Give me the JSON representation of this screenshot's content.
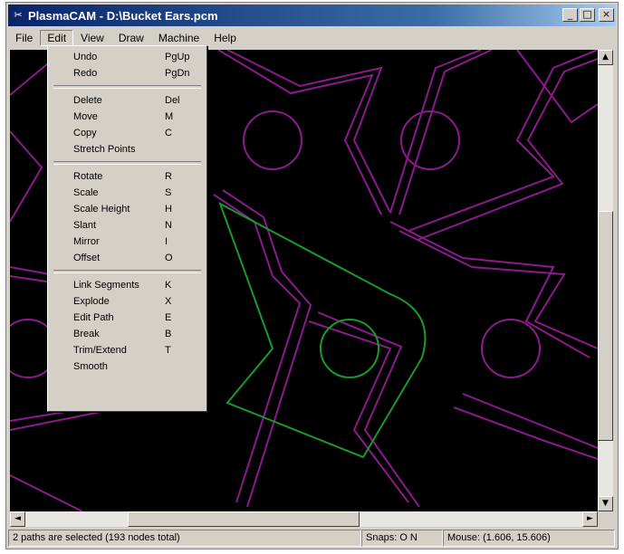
{
  "window": {
    "title": "PlasmaCAM - D:\\Bucket Ears.pcm",
    "title_icon": "plasmacam-app-icon",
    "controls": [
      {
        "name": "minimize-button",
        "glyph": "_"
      },
      {
        "name": "maximize-button",
        "glyph": "□"
      },
      {
        "name": "close-button",
        "glyph": "×"
      }
    ]
  },
  "menubar": {
    "items": [
      "File",
      "Edit",
      "View",
      "Draw",
      "Machine",
      "Help"
    ],
    "active": "Edit"
  },
  "edit_menu": {
    "groups": [
      [
        {
          "label": "Undo",
          "shortcut": "PgUp"
        },
        {
          "label": "Redo",
          "shortcut": "PgDn"
        }
      ],
      [
        {
          "label": "Delete",
          "shortcut": "Del"
        },
        {
          "label": "Move",
          "shortcut": "M"
        },
        {
          "label": "Copy",
          "shortcut": "C"
        },
        {
          "label": "Stretch Points",
          "shortcut": ""
        }
      ],
      [
        {
          "label": "Rotate",
          "shortcut": "R"
        },
        {
          "label": "Scale",
          "shortcut": "S"
        },
        {
          "label": "Scale Height",
          "shortcut": "H"
        },
        {
          "label": "Slant",
          "shortcut": "N"
        },
        {
          "label": "Mirror",
          "shortcut": "I"
        },
        {
          "label": "Offset",
          "shortcut": "O"
        }
      ],
      [
        {
          "label": "Link Segments",
          "shortcut": "K"
        },
        {
          "label": "Explode",
          "shortcut": "X"
        },
        {
          "label": "Edit Path",
          "shortcut": "E"
        },
        {
          "label": "Break",
          "shortcut": "B"
        },
        {
          "label": "Trim/Extend",
          "shortcut": "T"
        },
        {
          "label": "Smooth",
          "shortcut": ""
        }
      ]
    ]
  },
  "canvas": {
    "background": "#000000",
    "path_color": "#8c1a8c",
    "selected_color": "#1a9a2a"
  },
  "statusbar": {
    "selection": "2 paths are selected (193 nodes total)",
    "snaps": "Snaps: O N",
    "mouse": "Mouse: (1.606, 15.606)"
  },
  "scrollbars": {
    "up_arrow": "▲",
    "down_arrow": "▼",
    "left_arrow": "◄",
    "right_arrow": "►"
  }
}
